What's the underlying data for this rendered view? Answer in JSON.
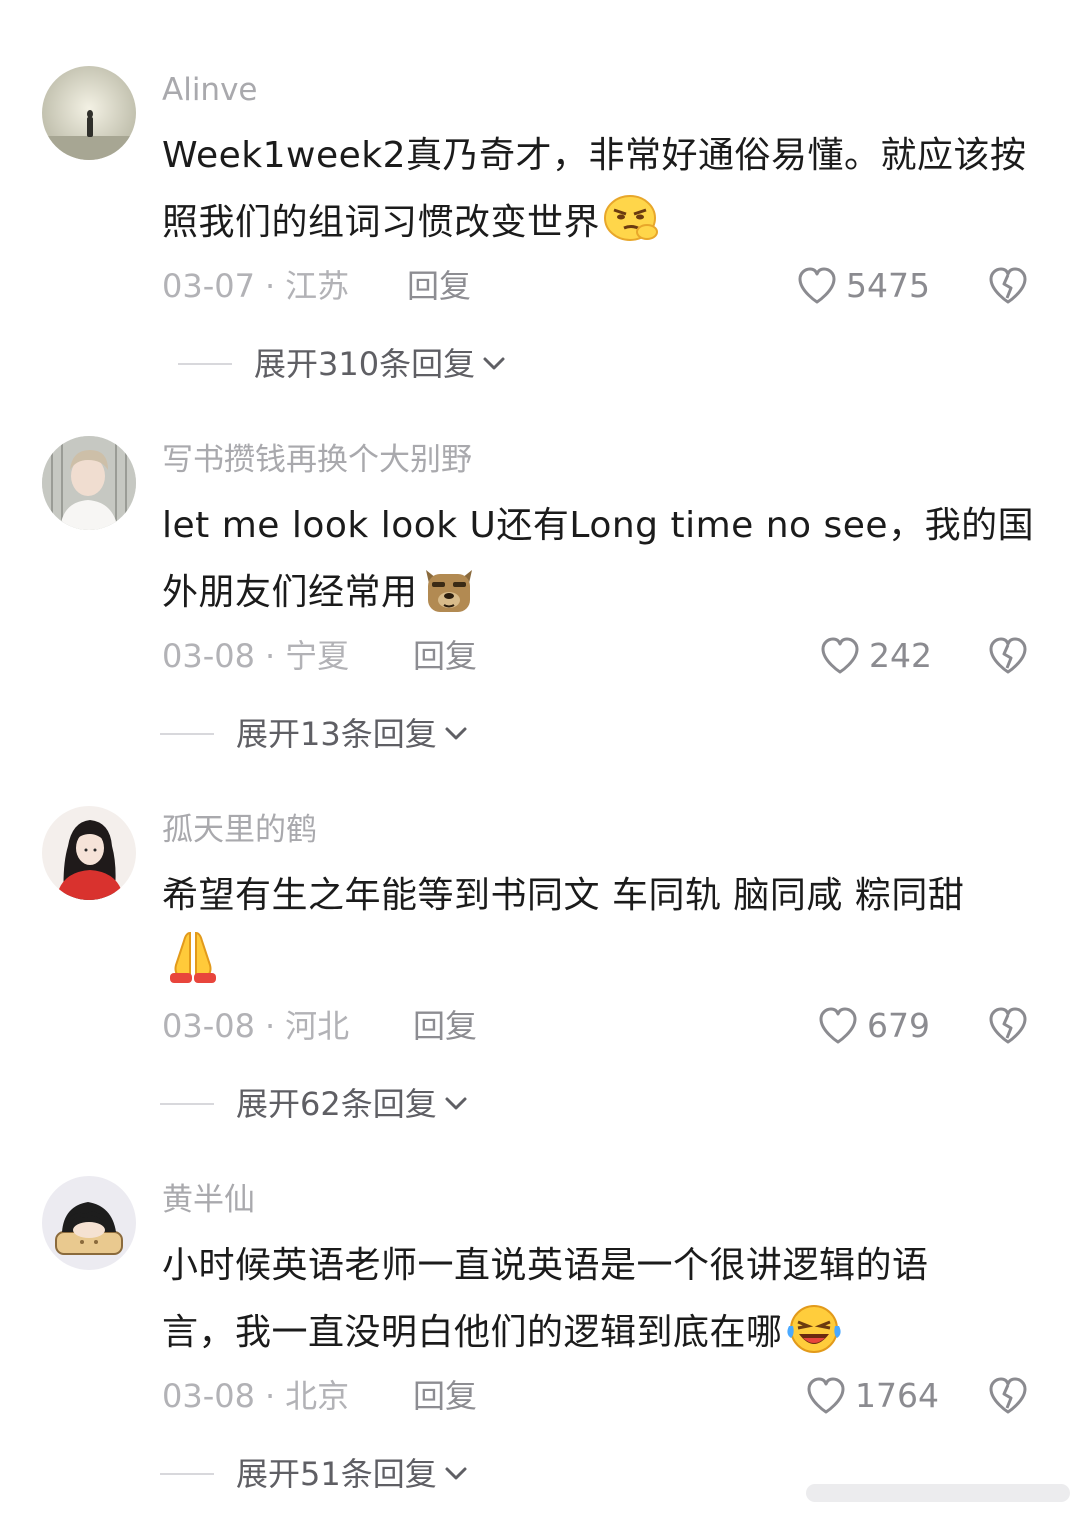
{
  "comments": [
    {
      "username": "Alinve",
      "text": "Week1week2真乃奇才，非常好通俗易懂。就应该按照我们的组词习惯改变世界",
      "emoji": "smug-face-emoji",
      "date": "03-07",
      "location": "江苏",
      "reply_label": "回复",
      "likes": "5475",
      "expand_label": "展开310条回复"
    },
    {
      "username": "写书攒钱再换个大别野",
      "text": "let me look look U还有Long time no see，我的国外朋友们经常用",
      "emoji": "dog-face-emoji",
      "date": "03-08",
      "location": "宁夏",
      "reply_label": "回复",
      "likes": "242",
      "expand_label": "展开13条回复"
    },
    {
      "username": "孤天里的鹤",
      "text": "希望有生之年能等到书同文 车同轨 脑同咸 粽同甜",
      "emoji": "praying-hands-emoji",
      "date": "03-08",
      "location": "河北",
      "reply_label": "回复",
      "likes": "679",
      "expand_label": "展开62条回复"
    },
    {
      "username": "黄半仙",
      "text": "小时候英语老师一直说英语是一个很讲逻辑的语言，我一直没明白他们的逻辑到底在哪",
      "emoji": "laughing-crying-emoji",
      "date": "03-08",
      "location": "北京",
      "reply_label": "回复",
      "likes": "1764",
      "expand_label": "展开51条回复"
    }
  ],
  "colors": {
    "meta": "#b2b2b6",
    "username": "#a9a9ad",
    "text": "#1b1b1b"
  }
}
